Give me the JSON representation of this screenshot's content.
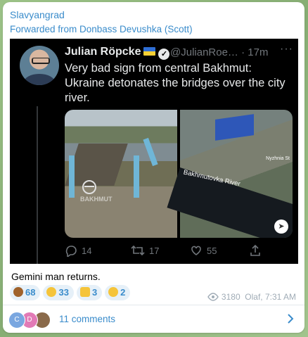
{
  "message": {
    "channel": "Slavyangrad",
    "forwarded_from": "Forwarded from Donbass Devushka (Scott)",
    "caption": "Gemini man returns.",
    "views": "3180",
    "author_time": "Olaf, 7:31 AM"
  },
  "tweet": {
    "name": "Julian Röpcke",
    "handle_time": "@JulianRoe… · 17m",
    "more": "···",
    "text": "Very bad sign from central Bakhmut: Ukraine detonates the bridges over the city river.",
    "photo1_watermark": "BAKHMUT",
    "photo2_label": "Bakhmutovka River",
    "photo2_corner_label": "Nyzhnia St",
    "replies": "14",
    "retweets": "17",
    "likes": "55"
  },
  "reactions": [
    {
      "emoji": "poop",
      "count": "68",
      "color": "#a0622b"
    },
    {
      "emoji": "grinning-face",
      "count": "33",
      "color": "#f5c43a"
    },
    {
      "emoji": "thumbs-up",
      "count": "3",
      "color": "#f5c43a"
    },
    {
      "emoji": "thinking-face",
      "count": "2",
      "color": "#f5c43a"
    }
  ],
  "comments": {
    "label": "11 comments",
    "avatars": [
      {
        "letter": "C",
        "color": "#7aa7e0"
      },
      {
        "letter": "D",
        "color": "#e27ab6"
      },
      {
        "letter": "",
        "color": "#8a6a4a"
      }
    ]
  },
  "colors": {
    "accent": "#3a8ccb",
    "tweet_bg": "#000000"
  }
}
